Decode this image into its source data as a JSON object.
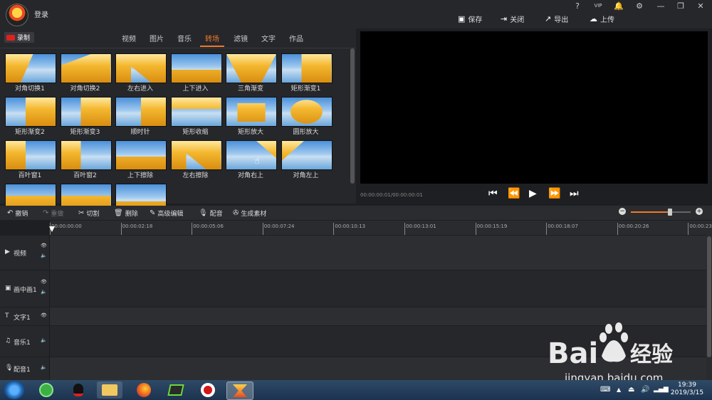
{
  "header": {
    "login": "登录",
    "window_buttons": [
      "?",
      "VIP",
      "🔔",
      "⚙",
      "—",
      "❐",
      "✕"
    ],
    "actions": [
      {
        "label": "保存",
        "icon": "save-icon"
      },
      {
        "label": "关闭",
        "icon": "close-project-icon"
      },
      {
        "label": "导出",
        "icon": "export-icon"
      },
      {
        "label": "上传",
        "icon": "upload-icon"
      }
    ]
  },
  "library": {
    "record_label": "录制",
    "tabs": [
      "视频",
      "图片",
      "音乐",
      "转场",
      "滤镜",
      "文字",
      "作品"
    ],
    "active_tab": "转场",
    "transitions": [
      "对角切换1",
      "对角切换2",
      "左右进入",
      "上下进入",
      "三角渐变",
      "矩形渐变1",
      "矩形渐变2",
      "矩形渐变3",
      "顺时针",
      "矩形收缩",
      "矩形放大",
      "圆形放大",
      "百叶窗1",
      "百叶窗2",
      "上下擦除",
      "左右擦除",
      "对角右上",
      "对角左上",
      "",
      "",
      ""
    ]
  },
  "preview": {
    "timecode": "00:00:00:01/00:00:00:01"
  },
  "toolbar": {
    "items": [
      {
        "label": "撤销",
        "icon": "undo-icon",
        "enabled": true
      },
      {
        "label": "重做",
        "icon": "redo-icon",
        "enabled": false
      },
      {
        "label": "切割",
        "icon": "scissors-icon",
        "enabled": true
      },
      {
        "label": "删除",
        "icon": "trash-icon",
        "enabled": true
      },
      {
        "label": "高级编辑",
        "icon": "pencil-icon",
        "enabled": true
      },
      {
        "label": "配音",
        "icon": "microphone-icon",
        "enabled": true
      },
      {
        "label": "生成素材",
        "icon": "film-reel-icon",
        "enabled": true
      }
    ],
    "zoom_level": 0.66
  },
  "timeline": {
    "ruler": [
      "00:00:00:00",
      "00:00:02:18",
      "00:00:05:06",
      "00:00:07:24",
      "00:00:10:13",
      "00:00:13:01",
      "00:00:15:19",
      "00:00:18:07",
      "00:00:20:26",
      "00:00:23:"
    ],
    "tracks": [
      {
        "name": "视频",
        "icon": "video-track-icon"
      },
      {
        "name": "画中画1",
        "icon": "pip-track-icon"
      },
      {
        "name": "文字1",
        "icon": "text-track-icon"
      },
      {
        "name": "音乐1",
        "icon": "music-track-icon"
      },
      {
        "name": "配音1",
        "icon": "mic-track-icon"
      }
    ]
  },
  "taskbar": {
    "time": "19:39",
    "date": "2019/3/15"
  },
  "watermark": {
    "brand": "Bai",
    "brand2": "经验",
    "url": "jingyan.baidu.com"
  },
  "colors": {
    "accent": "#f07828",
    "bg": "#1e1f22",
    "panel": "#26272b"
  }
}
